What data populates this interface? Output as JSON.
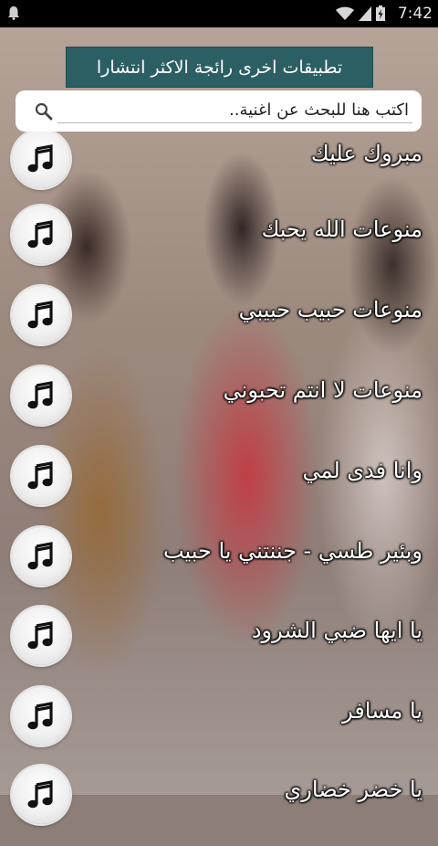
{
  "status_bar": {
    "time": "7:42"
  },
  "banner": {
    "label": "تطبيقات اخرى رائجة الاكثر انتشارا"
  },
  "search": {
    "placeholder": "اكتب هنا للبحث عن اغنية.."
  },
  "songs": [
    {
      "title": "مبروك عليك",
      "icon": "music-note-icon"
    },
    {
      "title": "منوعات الله يحبك",
      "icon": "music-note-icon"
    },
    {
      "title": "منوعات حبيب حبيبي",
      "icon": "music-note-icon"
    },
    {
      "title": "منوعات لا انتم تحبوني",
      "icon": "music-note-icon"
    },
    {
      "title": "وانا فدى لمي",
      "icon": "music-note-icon"
    },
    {
      "title": "وبئير طسي - جننتني يا حبيب",
      "icon": "music-note-icon"
    },
    {
      "title": "يا ايها ضبي الشرود",
      "icon": "music-note-icon"
    },
    {
      "title": "يا مسافر",
      "icon": "music-note-icon"
    },
    {
      "title": "يا خضر خضاري",
      "icon": "music-note-icon"
    }
  ],
  "colors": {
    "banner": "#2c5f63",
    "status_bar": "#000000"
  }
}
